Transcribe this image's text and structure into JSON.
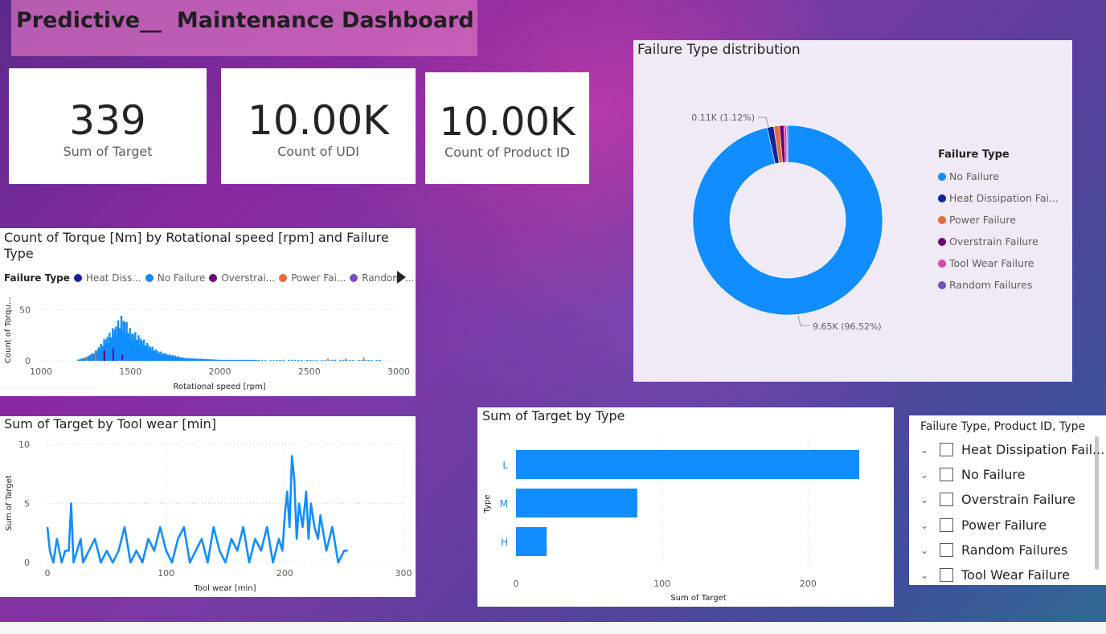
{
  "dashboard": {
    "title": "Predictive__  Maintenance Dashboard"
  },
  "kpis": [
    {
      "value": "339",
      "label": "Sum of Target"
    },
    {
      "value": "10.00K",
      "label": "Count of UDI"
    },
    {
      "value": "10.00K",
      "label": "Count of Product ID"
    }
  ],
  "torque_chart": {
    "title_line1": "Count of Torque [Nm] by Rotational speed [rpm] and Failure",
    "title_line2": "Type",
    "legend_title": "Failure Type",
    "legend": [
      {
        "label": "Heat Diss...",
        "color": "#12239e"
      },
      {
        "label": "No Failure",
        "color": "#118dff"
      },
      {
        "label": "Overstrai...",
        "color": "#6b007b"
      },
      {
        "label": "Power Fai...",
        "color": "#e66c37"
      },
      {
        "label": "Random ...",
        "color": "#744ec2"
      }
    ],
    "next_icon": "play-right-icon",
    "ylabel": "Count of Torqu...",
    "xlabel": "Rotational speed [rpm]",
    "yticks": [
      "50",
      "0"
    ],
    "xticks": [
      "1000",
      "1500",
      "2000",
      "2500",
      "3000"
    ]
  },
  "failure_donut": {
    "title": "Failure Type distribution",
    "legend_title": "Failure Type",
    "legend": [
      {
        "label": "No Failure",
        "color": "#118dff"
      },
      {
        "label": "Heat Dissipation Fai...",
        "color": "#12239e"
      },
      {
        "label": "Power Failure",
        "color": "#e66c37"
      },
      {
        "label": "Overstrain Failure",
        "color": "#6b007b"
      },
      {
        "label": "Tool Wear Failure",
        "color": "#e044a7"
      },
      {
        "label": "Random Failures",
        "color": "#744ec2"
      }
    ],
    "label_small": "0.11K (1.12%)",
    "label_large": "9.65K (96.52%)"
  },
  "toolwear_chart": {
    "title": "Sum of Target by Tool wear [min]",
    "ylabel": "Sum of Target",
    "xlabel": "Tool wear [min]",
    "yticks": [
      "10",
      "5",
      "0"
    ],
    "xticks": [
      "0",
      "100",
      "200",
      "300"
    ],
    "color": "#118dff"
  },
  "type_chart": {
    "title": "Sum of Target by Type",
    "ylabel": "Type",
    "xlabel": "Sum of Target",
    "xticks": [
      "0",
      "100",
      "200"
    ],
    "color": "#118dff"
  },
  "slicer": {
    "title": "Failure Type, Product ID, Type",
    "items": [
      "Heat Dissipation Fail...",
      "No Failure",
      "Overstrain Failure",
      "Power Failure",
      "Random Failures",
      "Tool Wear Failure"
    ]
  },
  "chart_data": [
    {
      "type": "pie",
      "title": "Failure Type distribution",
      "categories": [
        "No Failure",
        "Heat Dissipation Failure",
        "Power Failure",
        "Overstrain Failure",
        "Tool Wear Failure",
        "Random Failures"
      ],
      "values": [
        9652,
        112,
        95,
        78,
        45,
        18
      ],
      "labels": [
        "9.65K (96.52%)",
        "0.11K (1.12%)"
      ]
    },
    {
      "type": "bar",
      "title": "Sum of Target by Type",
      "categories": [
        "L",
        "M",
        "H"
      ],
      "values": [
        235,
        83,
        21
      ],
      "xlabel": "Sum of Target",
      "ylabel": "Type",
      "xlim": [
        0,
        235
      ]
    },
    {
      "type": "line",
      "title": "Sum of Target by Tool wear [min]",
      "xlabel": "Tool wear [min]",
      "ylabel": "Sum of Target",
      "xlim": [
        0,
        300
      ],
      "ylim": [
        0,
        10
      ],
      "x": [
        0,
        2,
        5,
        8,
        10,
        12,
        15,
        18,
        20,
        22,
        25,
        28,
        30,
        35,
        40,
        45,
        50,
        55,
        60,
        65,
        70,
        75,
        80,
        85,
        90,
        95,
        100,
        105,
        110,
        115,
        120,
        125,
        130,
        135,
        140,
        145,
        150,
        155,
        160,
        165,
        170,
        175,
        180,
        185,
        190,
        195,
        198,
        200,
        202,
        204,
        206,
        208,
        210,
        212,
        215,
        218,
        220,
        222,
        225,
        228,
        230,
        235,
        240,
        245,
        250,
        253
      ],
      "y": [
        3,
        1,
        0,
        2,
        1,
        0,
        1,
        1,
        5,
        0,
        1,
        2,
        0,
        1,
        2,
        0,
        1,
        0,
        1,
        3,
        0,
        1,
        0,
        2,
        1,
        3,
        1,
        0,
        2,
        3,
        0,
        1,
        2,
        0,
        3,
        1,
        0,
        2,
        1,
        3,
        0,
        2,
        1,
        3,
        0,
        2,
        1,
        4,
        6,
        3,
        9,
        7,
        2,
        5,
        3,
        6,
        2,
        5,
        3,
        2,
        4,
        1,
        3,
        0,
        1,
        1
      ]
    },
    {
      "type": "bar",
      "title": "Count of Torque [Nm] by Rotational speed [rpm] and Failure Type",
      "xlabel": "Rotational speed [rpm]",
      "ylabel": "Count of Torqu...",
      "xlim": [
        1000,
        3000
      ],
      "ylim": [
        0,
        55
      ],
      "series": [
        {
          "name": "No Failure",
          "x": [
            1200,
            1250,
            1300,
            1350,
            1400,
            1425,
            1450,
            1475,
            1500,
            1525,
            1550,
            1600,
            1650,
            1700,
            1750,
            1800,
            1900,
            2000,
            2100,
            2200,
            2400,
            2600,
            2800
          ],
          "values": [
            1,
            4,
            10,
            22,
            33,
            40,
            46,
            38,
            30,
            28,
            24,
            16,
            10,
            7,
            5,
            3,
            2,
            1,
            1,
            1,
            1,
            1,
            1
          ]
        },
        {
          "name": "Heat Dissipation Failure",
          "x": [
            1300,
            1350,
            1400
          ],
          "values": [
            6,
            10,
            8
          ]
        },
        {
          "name": "Power Failure",
          "x": [
            1250,
            1300,
            2600,
            2700,
            2800
          ],
          "values": [
            4,
            7,
            2,
            2,
            3
          ]
        },
        {
          "name": "Overstrain Failure",
          "x": [
            1350,
            1400,
            1450
          ],
          "values": [
            9,
            12,
            6
          ]
        },
        {
          "name": "Random Failures",
          "x": [
            1450,
            1500
          ],
          "values": [
            1,
            1
          ]
        }
      ]
    }
  ]
}
